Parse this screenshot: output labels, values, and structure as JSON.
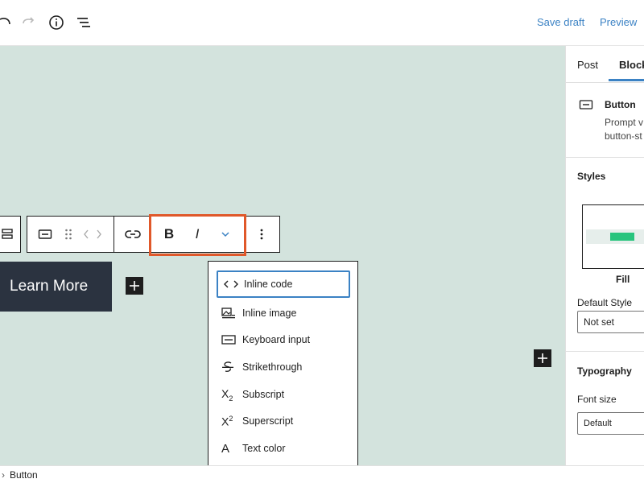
{
  "header": {
    "save_draft": "Save draft",
    "preview": "Preview",
    "icons": [
      "undo-icon",
      "redo-icon",
      "info-icon",
      "list-view-icon"
    ]
  },
  "toolbar": {
    "bold": "B",
    "italic": "I"
  },
  "block": {
    "button_text": "Learn More"
  },
  "dropdown": {
    "items": [
      {
        "label": "Inline code",
        "icon": "‹ ›",
        "selected": true
      },
      {
        "label": "Inline image",
        "icon": "inline-image-icon"
      },
      {
        "label": "Keyboard input",
        "icon": "keyboard-icon"
      },
      {
        "label": "Strikethrough",
        "icon": "strikethrough-icon"
      },
      {
        "label": "Subscript",
        "icon": "subscript-icon"
      },
      {
        "label": "Superscript",
        "icon": "superscript-icon"
      },
      {
        "label": "Text color",
        "icon": "A"
      }
    ]
  },
  "sidebar": {
    "tabs": [
      "Post",
      "Block"
    ],
    "block_name": "Button",
    "block_desc_line1": "Prompt v",
    "block_desc_line2": "button-st",
    "styles_heading": "Styles",
    "style_label": "Fill",
    "default_style_label": "Default Style",
    "default_style_value": "Not set",
    "typography_heading": "Typography",
    "font_size_label": "Font size",
    "font_size_value": "Default"
  },
  "footer": {
    "breadcrumb": "Button"
  },
  "colors": {
    "canvas_bg": "#d3e3dd",
    "accent": "#3b82c4",
    "highlight": "#e0582a",
    "button_bg": "#2b3340"
  }
}
